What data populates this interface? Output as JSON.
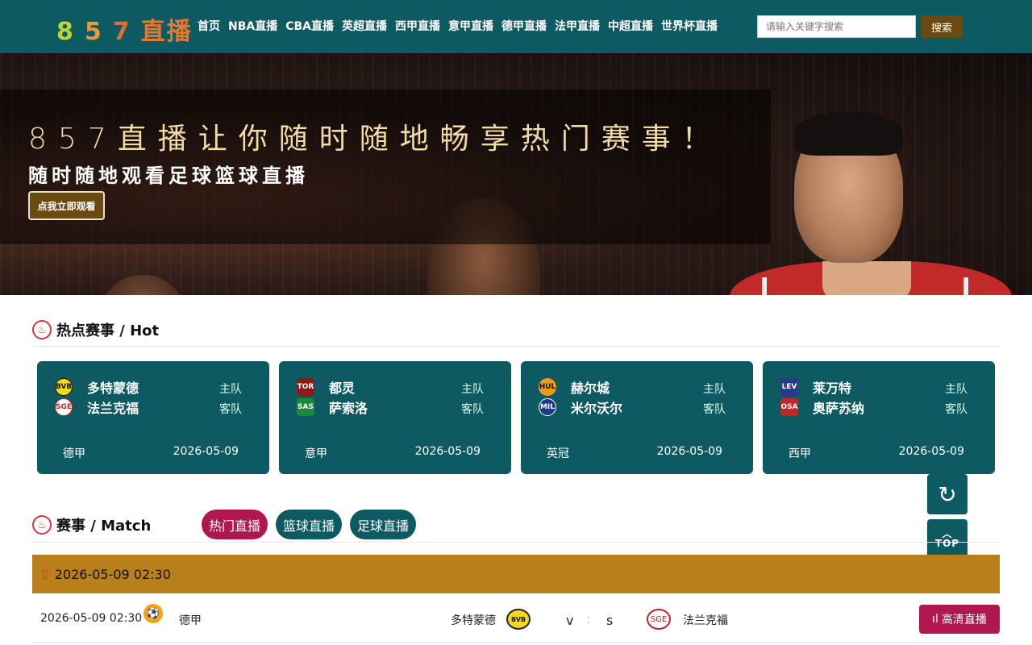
{
  "logo": {
    "digit1": "8",
    "digit2": "5",
    "digit3": "7",
    "text": "直播"
  },
  "nav": [
    "首页",
    "NBA直播",
    "CBA直播",
    "英超直播",
    "西甲直播",
    "意甲直播",
    "德甲直播",
    "法甲直播",
    "中超直播",
    "世界杯直播"
  ],
  "search": {
    "placeholder": "请输入关键字搜索",
    "button": "搜索"
  },
  "banner": {
    "headline": "857直播让你随时随地畅享热门赛事！",
    "subline": "随时随地观看足球篮球直播",
    "cta": "点我立即观看"
  },
  "hot": {
    "title": "热点赛事 / Hot",
    "cards": [
      {
        "home": "多特蒙德",
        "away": "法兰克福",
        "home_role": "主队",
        "away_role": "客队",
        "league": "德甲",
        "date": "2026-05-09"
      },
      {
        "home": "都灵",
        "away": "萨索洛",
        "home_role": "主队",
        "away_role": "客队",
        "league": "意甲",
        "date": "2026-05-09"
      },
      {
        "home": "赫尔城",
        "away": "米尔沃尔",
        "home_role": "主队",
        "away_role": "客队",
        "league": "英冠",
        "date": "2026-05-09"
      },
      {
        "home": "莱万特",
        "away": "奥萨苏纳",
        "home_role": "主队",
        "away_role": "客队",
        "league": "西甲",
        "date": "2026-05-09"
      }
    ]
  },
  "match": {
    "title": "赛事 / Match",
    "tabs": [
      "热门直播",
      "篮球直播",
      "足球直播"
    ],
    "date_header": "2026-05-09 02:30",
    "rows": [
      {
        "time": "2026-05-09 02:30",
        "league": "德甲",
        "home": "多特蒙德",
        "away": "法兰克福",
        "v": "v",
        "s": "s",
        "watch": "高清直播"
      }
    ]
  },
  "float": {
    "top_label": "TOP"
  },
  "colors": {
    "primary": "#0e5a62",
    "accent": "#b0174f",
    "gold": "#b87f1a",
    "button_brown": "#6b4a10"
  }
}
